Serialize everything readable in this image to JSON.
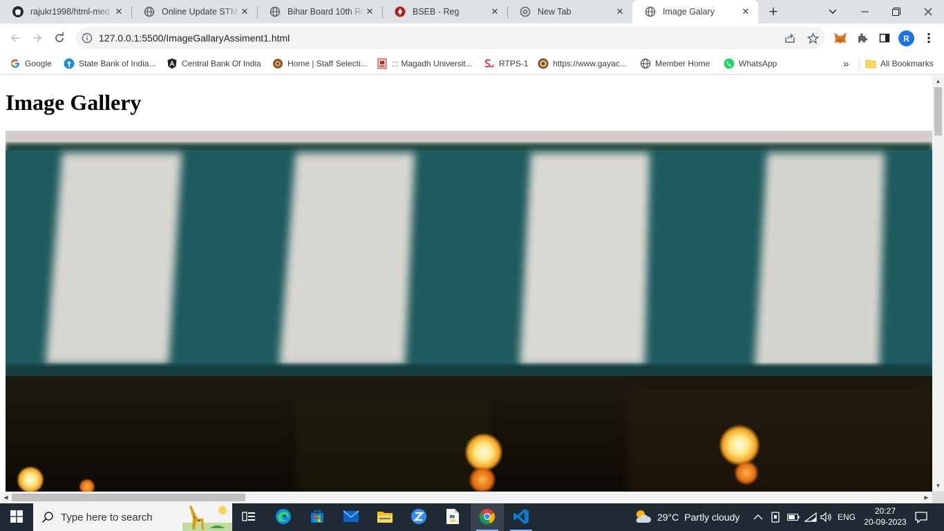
{
  "browser": {
    "tabs": [
      {
        "title": "rajukr1998/html-med",
        "icon": "github-icon",
        "active": false
      },
      {
        "title": "Online Update STM -",
        "icon": "globe-icon",
        "active": false
      },
      {
        "title": "Bihar Board 10th Reg",
        "icon": "globe-icon",
        "active": false
      },
      {
        "title": "BSEB - Reg",
        "icon": "bseb-logo-icon",
        "active": false
      },
      {
        "title": "New Tab",
        "icon": "chrome-icon",
        "active": false
      },
      {
        "title": "Image Galary",
        "icon": "globe-icon",
        "active": true
      }
    ],
    "address": {
      "url": "127.0.0.1:5500/ImageGallaryAssiment1.html"
    },
    "profile_initial": "R",
    "bookmarks": [
      {
        "label": "Google",
        "icon": "google-icon"
      },
      {
        "label": "State Bank of India...",
        "icon": "sbi-icon"
      },
      {
        "label": "Central Bank Of India",
        "icon": "angular-icon"
      },
      {
        "label": "Home | Staff Selecti...",
        "icon": "ssc-icon"
      },
      {
        "label": "::: Magadh Universit...",
        "icon": "magadh-icon"
      },
      {
        "label": "RTPS-1",
        "icon": "rtps-icon"
      },
      {
        "label": "https://www.gayac...",
        "icon": "gaya-icon"
      },
      {
        "label": "Member Home",
        "icon": "globe-icon"
      },
      {
        "label": "WhatsApp",
        "icon": "whatsapp-icon"
      }
    ],
    "all_bookmarks_label": "All Bookmarks"
  },
  "page": {
    "heading": "Image Gallery"
  },
  "taskbar": {
    "search_placeholder": "Type here to search",
    "weather": {
      "temp": "29°C",
      "condition": "Partly cloudy"
    },
    "language": "ENG",
    "time": "20:27",
    "date": "20-09-2023"
  },
  "colors": {
    "awning_green": "#1e5b5e",
    "awning_white": "#d8d6d0",
    "taskbar_bg": "#1f2a34"
  }
}
